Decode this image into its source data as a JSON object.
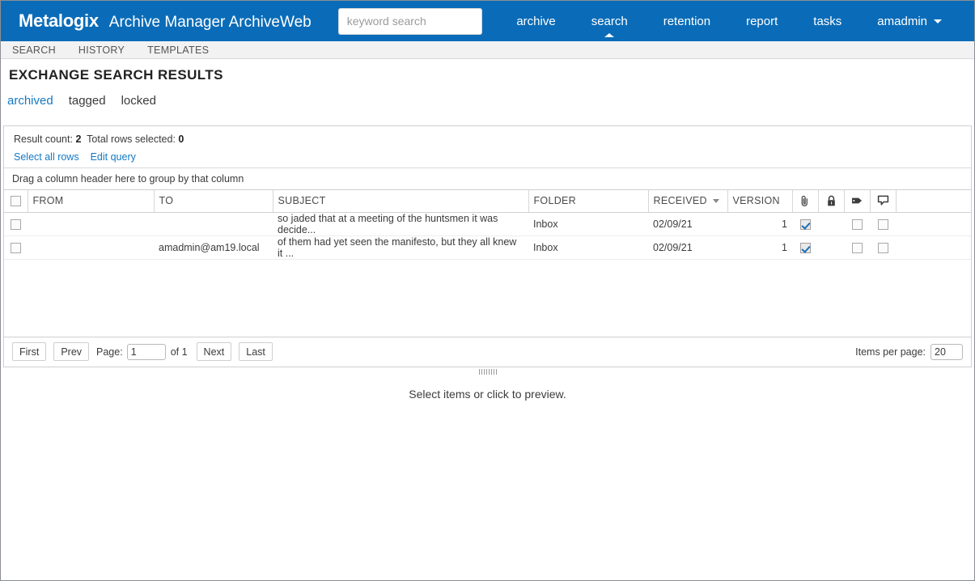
{
  "header": {
    "brand_logo": "Metalogix",
    "brand_title": "Archive Manager ArchiveWeb",
    "search_placeholder": "keyword search",
    "search_value": "",
    "accent_color": "#0a6cb8",
    "nav": [
      {
        "label": "archive",
        "active": false
      },
      {
        "label": "search",
        "active": true
      },
      {
        "label": "retention",
        "active": false
      },
      {
        "label": "report",
        "active": false
      },
      {
        "label": "tasks",
        "active": false
      },
      {
        "label": "amadmin",
        "active": false,
        "has_dropdown": true
      }
    ]
  },
  "subtabs": [
    {
      "label": "SEARCH"
    },
    {
      "label": "HISTORY"
    },
    {
      "label": "TEMPLATES"
    }
  ],
  "page": {
    "title": "EXCHANGE SEARCH RESULTS",
    "filters": [
      {
        "label": "archived",
        "active": true
      },
      {
        "label": "tagged",
        "active": false
      },
      {
        "label": "locked",
        "active": false
      }
    ],
    "link_color": "#1479c4"
  },
  "results": {
    "result_count_label": "Result count:",
    "result_count_value": "2",
    "total_selected_label": "Total rows selected:",
    "total_selected_value": "0",
    "select_all_label": "Select all rows",
    "edit_query_label": "Edit query",
    "group_bar_text": "Drag a column header here to group by that column"
  },
  "table": {
    "columns": [
      {
        "key": "check",
        "label": "",
        "type": "checkbox"
      },
      {
        "key": "from",
        "label": "FROM"
      },
      {
        "key": "to",
        "label": "TO"
      },
      {
        "key": "subject",
        "label": "SUBJECT"
      },
      {
        "key": "folder",
        "label": "FOLDER"
      },
      {
        "key": "received",
        "label": "RECEIVED",
        "sort": "desc"
      },
      {
        "key": "version",
        "label": "VERSION"
      },
      {
        "key": "attachment",
        "label": "",
        "icon": "paperclip-icon"
      },
      {
        "key": "locked",
        "label": "",
        "icon": "padlock-icon"
      },
      {
        "key": "tag",
        "label": "",
        "icon": "tag-icon"
      },
      {
        "key": "comment",
        "label": "",
        "icon": "comment-icon"
      }
    ],
    "rows": [
      {
        "selected": false,
        "from": "",
        "to": "",
        "subject": "so jaded that at a meeting of the huntsmen it was decide...",
        "folder": "Inbox",
        "received": "02/09/21",
        "version": "1",
        "attachment": true,
        "locked": null,
        "tag": false,
        "comment": false
      },
      {
        "selected": false,
        "from": "",
        "to": "amadmin@am19.local",
        "subject": "of them had yet seen the manifesto, but they all knew it ...",
        "folder": "Inbox",
        "received": "02/09/21",
        "version": "1",
        "attachment": true,
        "locked": null,
        "tag": false,
        "comment": false
      }
    ]
  },
  "pager": {
    "first": "First",
    "prev": "Prev",
    "page_label": "Page:",
    "page_value": "1",
    "of_label": "of 1",
    "next": "Next",
    "last": "Last",
    "items_per_page_label": "Items per page:",
    "items_per_page_value": "20"
  },
  "preview": {
    "text": "Select items or click to preview."
  }
}
